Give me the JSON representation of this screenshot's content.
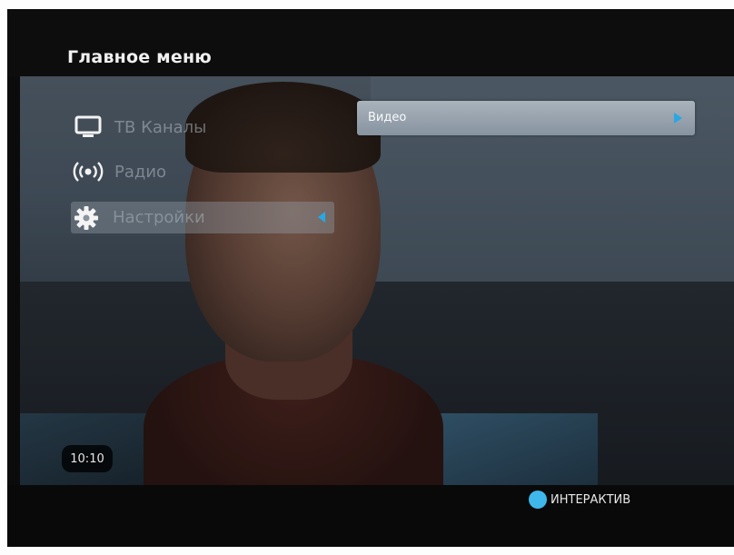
{
  "menu": {
    "title": "Главное меню",
    "items": [
      {
        "label": "ТВ Каналы",
        "icon": "tv-icon"
      },
      {
        "label": "Радио",
        "icon": "radio-icon"
      },
      {
        "label": "Настройки",
        "icon": "gear-icon",
        "selected": true
      }
    ]
  },
  "submenu": {
    "label": "Видео",
    "icon": "arrow-right-icon"
  },
  "clock": {
    "time": "10:10"
  },
  "hint": {
    "label": "ИНТЕРАКТИВ",
    "color": "#3fb7ea"
  }
}
